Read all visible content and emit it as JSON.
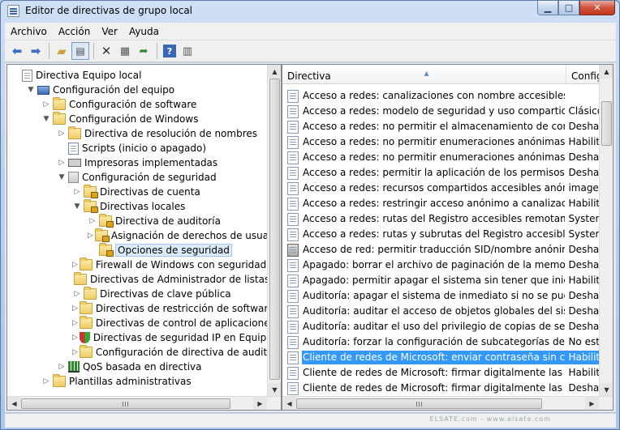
{
  "window": {
    "title": "Editor de directivas de grupo local"
  },
  "menu": [
    "Archivo",
    "Acción",
    "Ver",
    "Ayuda"
  ],
  "toolbar": {
    "icons": [
      "back-icon",
      "forward-icon",
      "up-folder-icon",
      "show-hide-tree-icon",
      "delete-icon",
      "properties-icon",
      "export-list-icon",
      "help-icon",
      "filter-icon"
    ]
  },
  "tree": [
    {
      "label": "Directiva Equipo local",
      "depth": 0,
      "twisty": "",
      "icon": "doc"
    },
    {
      "label": "Configuración del equipo",
      "depth": 1,
      "twisty": "▼",
      "icon": "pc"
    },
    {
      "label": "Configuración de software",
      "depth": 2,
      "twisty": "▷",
      "icon": "folder"
    },
    {
      "label": "Configuración de Windows",
      "depth": 2,
      "twisty": "▼",
      "icon": "folder"
    },
    {
      "label": "Directiva de resolución de nombres",
      "depth": 3,
      "twisty": "▷",
      "icon": "folder"
    },
    {
      "label": "Scripts (inicio o apagado)",
      "depth": 3,
      "twisty": "",
      "icon": "doc"
    },
    {
      "label": "Impresoras implementadas",
      "depth": 3,
      "twisty": "▷",
      "icon": "printer"
    },
    {
      "label": "Configuración de seguridad",
      "depth": 3,
      "twisty": "▼",
      "icon": "clip"
    },
    {
      "label": "Directivas de cuenta",
      "depth": 4,
      "twisty": "▷",
      "icon": "lockfolder"
    },
    {
      "label": "Directivas locales",
      "depth": 4,
      "twisty": "▼",
      "icon": "lockfolder"
    },
    {
      "label": "Directiva de auditoría",
      "depth": 5,
      "twisty": "▷",
      "icon": "lockfolder"
    },
    {
      "label": "Asignación de derechos de usuario",
      "depth": 5,
      "twisty": "▷",
      "icon": "lockfolder"
    },
    {
      "label": "Opciones de seguridad",
      "depth": 5,
      "twisty": "",
      "icon": "lockfolder",
      "selected": true
    },
    {
      "label": "Firewall de Windows con seguridad avan",
      "depth": 4,
      "twisty": "▷",
      "icon": "folder"
    },
    {
      "label": "Directivas de Administrador de listas de r",
      "depth": 4,
      "twisty": "",
      "icon": "folder"
    },
    {
      "label": "Directivas de clave pública",
      "depth": 4,
      "twisty": "▷",
      "icon": "folder"
    },
    {
      "label": "Directivas de restricción de software",
      "depth": 4,
      "twisty": "▷",
      "icon": "folder"
    },
    {
      "label": "Directivas de control de aplicaciones",
      "depth": 4,
      "twisty": "▷",
      "icon": "folder"
    },
    {
      "label": "Directivas de seguridad IP en Equipo loca",
      "depth": 4,
      "twisty": "▷",
      "icon": "shield"
    },
    {
      "label": "Configuración de directiva de auditoría a",
      "depth": 4,
      "twisty": "▷",
      "icon": "folder"
    },
    {
      "label": "QoS basada en directiva",
      "depth": 3,
      "twisty": "▷",
      "icon": "chart"
    },
    {
      "label": "Plantillas administrativas",
      "depth": 2,
      "twisty": "▷",
      "icon": "folder"
    }
  ],
  "list": {
    "columns": [
      "Directiva",
      "Configu"
    ],
    "rows": [
      {
        "name": "Acceso a redes: canalizaciones con nombre accesibles anóni...",
        "setting": ""
      },
      {
        "name": "Acceso a redes: modelo de seguridad y uso compartido par...",
        "setting": "Clásico"
      },
      {
        "name": "Acceso a redes: no permitir el almacenamiento de contrase...",
        "setting": "Deshab"
      },
      {
        "name": "Acceso a redes: no permitir enumeraciones anónimas de cu...",
        "setting": "Habilita"
      },
      {
        "name": "Acceso a redes: no permitir enumeraciones anónimas de cu...",
        "setting": "Deshab"
      },
      {
        "name": "Acceso a redes: permitir la aplicación de los permisos Todos...",
        "setting": "Deshab"
      },
      {
        "name": "Acceso a redes: recursos compartidos accesibles anónimam...",
        "setting": "imager"
      },
      {
        "name": "Acceso a redes: restringir acceso anónimo a canalizaciones ...",
        "setting": "Habilita"
      },
      {
        "name": "Acceso a redes: rutas del Registro accesibles remotamente",
        "setting": "System"
      },
      {
        "name": "Acceso a redes: rutas y subrutas del Registro accesibles rem...",
        "setting": "System"
      },
      {
        "name": "Acceso de red: permitir traducción SID/nombre anónima",
        "setting": "Deshab",
        "icon": "server"
      },
      {
        "name": "Apagado: borrar el archivo de paginación de la memoria virt...",
        "setting": "Deshab"
      },
      {
        "name": "Apagado: permitir apagar el sistema sin tener que iniciar ses...",
        "setting": "Habilita"
      },
      {
        "name": "Auditoría: apagar el sistema de inmediato si no se pueden re...",
        "setting": "Deshab"
      },
      {
        "name": "Auditoría: auditar el acceso de objetos globales del sistema",
        "setting": "Deshab"
      },
      {
        "name": "Auditoría: auditar el uso del privilegio de copias de segurida...",
        "setting": "Deshab"
      },
      {
        "name": "Auditoría: forzar la configuración de subcategorías de la dire...",
        "setting": "No esta"
      },
      {
        "name": "Cliente de redes de Microsoft: enviar contraseña sin cifrar a ...",
        "setting": "Habilita",
        "selected": true
      },
      {
        "name": "Cliente de redes de Microsoft: firmar digitalmente las comu...",
        "setting": "Habilita"
      },
      {
        "name": "Cliente de redes de Microsoft: firmar digitalmente las comu...",
        "setting": "Deshab"
      }
    ]
  },
  "watermark": "ELSATE.com - www.elsate.com"
}
